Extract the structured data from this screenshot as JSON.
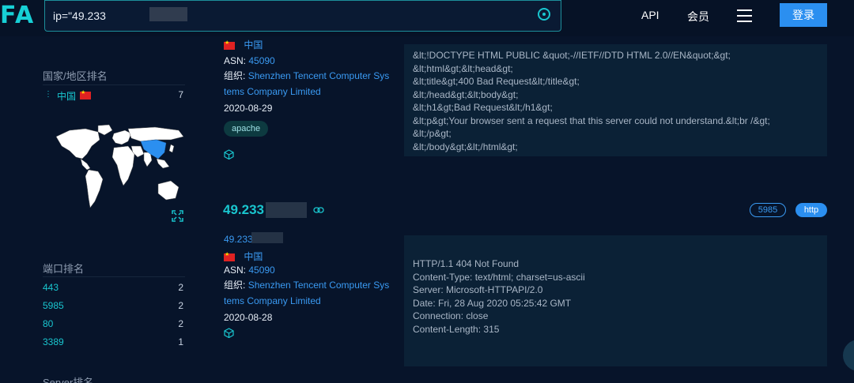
{
  "header": {
    "logo": "FA",
    "search_value": "ip=\"49.233",
    "nav": {
      "api": "API",
      "member": "会员"
    },
    "login_label": "登录"
  },
  "sidebar": {
    "country_title": "国家/地区排名",
    "countries": [
      {
        "dots": "⋮",
        "name": "中国",
        "count": "7"
      }
    ],
    "port_title": "端口排名",
    "ports": [
      {
        "port": "443",
        "count": "2"
      },
      {
        "port": "5985",
        "count": "2"
      },
      {
        "port": "80",
        "count": "2"
      },
      {
        "port": "3389",
        "count": "1"
      }
    ],
    "server_title": "Server排名"
  },
  "result1": {
    "country": "中国",
    "asn_label": "ASN:",
    "asn": "45090",
    "org_label": "组织:",
    "org": "Shenzhen Tencent Computer Systems Company Limited",
    "date": "2020-08-29",
    "tag": "apache",
    "banner": [
      "&lt;!DOCTYPE HTML PUBLIC &quot;-//IETF//DTD HTML 2.0//EN&quot;&gt;",
      "&lt;html&gt;&lt;head&gt;",
      "&lt;title&gt;400 Bad Request&lt;/title&gt;",
      "&lt;/head&gt;&lt;body&gt;",
      "&lt;h1&gt;Bad Request&lt;/h1&gt;",
      "&lt;p&gt;Your browser sent a request that this server could not understand.&lt;br /&gt;",
      "&lt;/p&gt;",
      "&lt;/body&gt;&lt;/html&gt;"
    ]
  },
  "result2": {
    "ip": "49.233",
    "ip_sub": "49.233",
    "port": "5985",
    "protocol": "http",
    "country": "中国",
    "asn_label": "ASN:",
    "asn": "45090",
    "org_label": "组织:",
    "org": "Shenzhen Tencent Computer Systems Company Limited",
    "date": "2020-08-28",
    "banner": [
      "HTTP/1.1 404 Not Found",
      "Content-Type: text/html; charset=us-ascii",
      "Server: Microsoft-HTTPAPI/2.0",
      "Date: Fri, 28 Aug 2020 05:25:42 GMT",
      "Connection: close",
      "Content-Length: 315"
    ]
  },
  "colors": {
    "accent": "#19c6cf",
    "link": "#3a9af2",
    "button": "#2b8ff0",
    "background": "#07142a"
  }
}
